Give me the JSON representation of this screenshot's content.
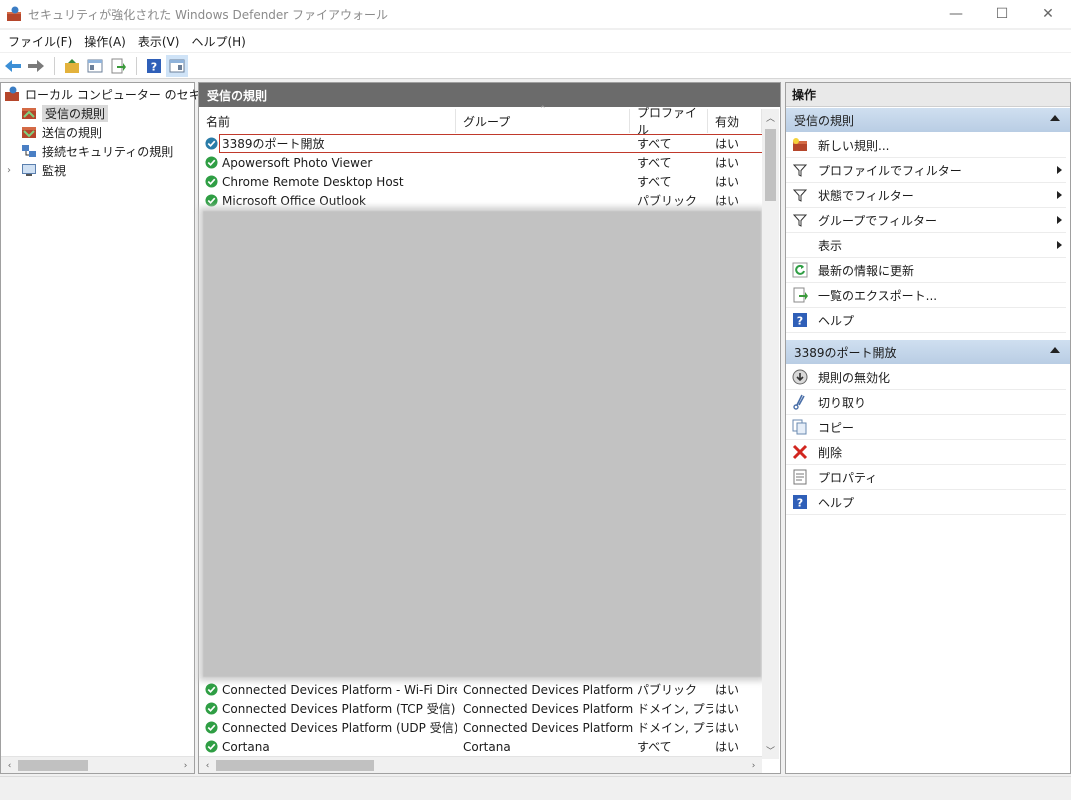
{
  "window": {
    "title": "セキュリティが強化された Windows Defender ファイアウォール",
    "minimize": "—",
    "maximize": "☐",
    "close": "✕"
  },
  "menu": [
    "ファイル(F)",
    "操作(A)",
    "表示(V)",
    "ヘルプ(H)"
  ],
  "toolbar": {
    "icons": [
      "back-arrow-icon",
      "forward-arrow-icon",
      "folder-up-icon",
      "show-hide-console-tree-icon",
      "export-icon",
      "help-icon",
      "show-hide-action-pane-icon"
    ]
  },
  "tree": {
    "root": "ローカル コンピューター のセキュリティが",
    "items": [
      {
        "label": "受信の規則",
        "icon": "inbound-rules-icon",
        "selected": true
      },
      {
        "label": "送信の規則",
        "icon": "outbound-rules-icon",
        "selected": false
      },
      {
        "label": "接続セキュリティの規則",
        "icon": "connection-security-icon",
        "selected": false
      },
      {
        "label": "監視",
        "icon": "monitor-icon",
        "selected": false
      }
    ]
  },
  "center": {
    "header": "受信の規則",
    "columns": {
      "name": "名前",
      "group": "グループ",
      "profile": "プロファイル",
      "enabled": "有効"
    },
    "rows_top": [
      {
        "name": "3389のポート開放",
        "group": "",
        "profile": "すべて",
        "enabled": "はい",
        "highlight": true
      },
      {
        "name": "Apowersoft Photo Viewer",
        "group": "",
        "profile": "すべて",
        "enabled": "はい"
      },
      {
        "name": "Chrome Remote Desktop Host",
        "group": "",
        "profile": "すべて",
        "enabled": "はい"
      },
      {
        "name": "Microsoft Office Outlook",
        "group": "",
        "profile": "パブリック",
        "enabled": "はい"
      }
    ],
    "rows_bottom": [
      {
        "name": "Connected Devices Platform - Wi-Fi Direct...",
        "group": "Connected Devices Platform",
        "profile": "パブリック",
        "enabled": "はい"
      },
      {
        "name": "Connected Devices Platform (TCP 受信)",
        "group": "Connected Devices Platform",
        "profile": "ドメイン, プラ...",
        "enabled": "はい"
      },
      {
        "name": "Connected Devices Platform (UDP 受信)",
        "group": "Connected Devices Platform",
        "profile": "ドメイン, プラ...",
        "enabled": "はい"
      },
      {
        "name": "Cortana",
        "group": "Cortana",
        "profile": "すべて",
        "enabled": "はい"
      }
    ]
  },
  "actions": {
    "header": "操作",
    "section1": {
      "title": "受信の規則",
      "items": [
        {
          "label": "新しい規則...",
          "icon": "new-rule-icon",
          "submenu": false
        },
        {
          "label": "プロファイルでフィルター",
          "icon": "filter-icon",
          "submenu": true
        },
        {
          "label": "状態でフィルター",
          "icon": "filter-icon",
          "submenu": true
        },
        {
          "label": "グループでフィルター",
          "icon": "filter-icon",
          "submenu": true
        },
        {
          "label": "表示",
          "icon": "",
          "submenu": true
        },
        {
          "label": "最新の情報に更新",
          "icon": "refresh-icon",
          "submenu": false
        },
        {
          "label": "一覧のエクスポート...",
          "icon": "export-icon",
          "submenu": false
        },
        {
          "label": "ヘルプ",
          "icon": "help-icon",
          "submenu": false
        }
      ]
    },
    "section2": {
      "title": "3389のポート開放",
      "items": [
        {
          "label": "規則の無効化",
          "icon": "disable-rule-icon"
        },
        {
          "label": "切り取り",
          "icon": "cut-icon"
        },
        {
          "label": "コピー",
          "icon": "copy-icon"
        },
        {
          "label": "削除",
          "icon": "delete-icon"
        },
        {
          "label": "プロパティ",
          "icon": "properties-icon"
        },
        {
          "label": "ヘルプ",
          "icon": "help-icon"
        }
      ]
    }
  },
  "colors": {
    "highlight_border": "#c0392b",
    "section_header": "#c4d6ea",
    "check_green": "#2f9e44"
  }
}
